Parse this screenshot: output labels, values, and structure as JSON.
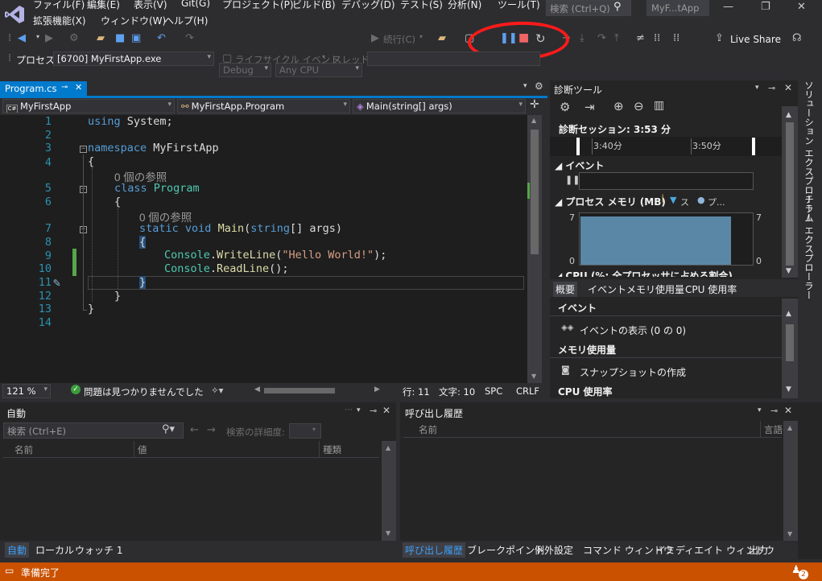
{
  "menu": {
    "items": [
      "ファイル(F)",
      "編集(E)",
      "表示(V)",
      "Git(G)",
      "プロジェクト(P)",
      "ビルド(B)",
      "デバッグ(D)",
      "テスト(S)",
      "分析(N)",
      "ツール(T)",
      "拡張機能(X)",
      "ウィンドウ(W)",
      "ヘルプ(H)"
    ],
    "search_placeholder": "検索 (Ctrl+Q)",
    "solution_title": "MyF...tApp"
  },
  "toolbar": {
    "config": "Debug",
    "platform": "Any CPU",
    "continue_label": "続行(C)",
    "live_share": "Live Share",
    "process_label": "プロセス:",
    "process_value": "[6700] MyFirstApp.exe",
    "lifecycle_label": "ライフサイクル イベント",
    "thread_label": "スレッド:"
  },
  "editor": {
    "tab_label": "Program.cs",
    "nav_project": "MyFirstApp",
    "nav_class": "MyFirstApp.Program",
    "nav_member": "Main(string[] args)",
    "lines": [
      "1",
      "2",
      "3",
      "4",
      "",
      "5",
      "6",
      "",
      "7",
      "8",
      "9",
      "10",
      "11",
      "12",
      "13",
      "14"
    ],
    "ref_count": "0 個の参照",
    "code": {
      "using": "using",
      "system": "System;",
      "namespace": "namespace",
      "ns_name": "MyFirstApp",
      "brace_open": "{",
      "brace_close": "}",
      "class": "class",
      "class_name": "Program",
      "static": "static",
      "void": "void",
      "main": "Main",
      "lparen": "(",
      "string": "string",
      "args_sig": "[] args)",
      "console": "Console",
      "writeline": "WriteLine",
      "hello": "\"Hello World!\"",
      "end1": ");",
      "readline": "ReadLine",
      "end2": "();",
      "dot": "."
    },
    "zoom": "121 %",
    "issues": "問題は見つかりませんでした",
    "line_col": "行: 11",
    "char_col": "文字: 10",
    "spc": "SPC",
    "crlf": "CRLF"
  },
  "diagnostics": {
    "title": "診断ツール",
    "session": "診断セッション: 3:53 分",
    "ticks": [
      "3:40分",
      "3:50分"
    ],
    "events_header": "イベント",
    "memory_header": "プロセス メモリ (MB)",
    "memory_legend_1": "ス",
    "memory_legend_2": "プ...",
    "mem_axis_top": "7",
    "mem_axis_bottom": "0",
    "cpu_header": "CPU (%: 全プロセッサに占める割合)",
    "tabs": [
      "概要",
      "イベント",
      "メモリ使用量",
      "CPU 使用率"
    ],
    "sec_events": "イベント",
    "show_events": "イベントの表示 (0 の 0)",
    "sec_memory": "メモリ使用量",
    "snapshot": "スナップショットの作成",
    "sec_cpu": "CPU 使用率"
  },
  "auto_panel": {
    "title": "自動",
    "search_placeholder": "検索 (Ctrl+E)",
    "search_depth": "検索の詳細度:",
    "columns": [
      "名前",
      "値",
      "種類"
    ],
    "tabs": [
      "自動",
      "ローカル",
      "ウォッチ 1"
    ]
  },
  "call_panel": {
    "title": "呼び出し履歴",
    "columns": [
      "名前",
      "言語"
    ],
    "tabs": [
      "呼び出し履歴",
      "ブレークポイント",
      "例外設定",
      "コマンド ウィンドウ",
      "イミディエイト ウィンドウ",
      "出力"
    ]
  },
  "right_rail": [
    "ソリューション エクスプローラー",
    "チーム エクスプローラー"
  ],
  "status": {
    "ready": "準備完了",
    "notif_count": "2"
  }
}
